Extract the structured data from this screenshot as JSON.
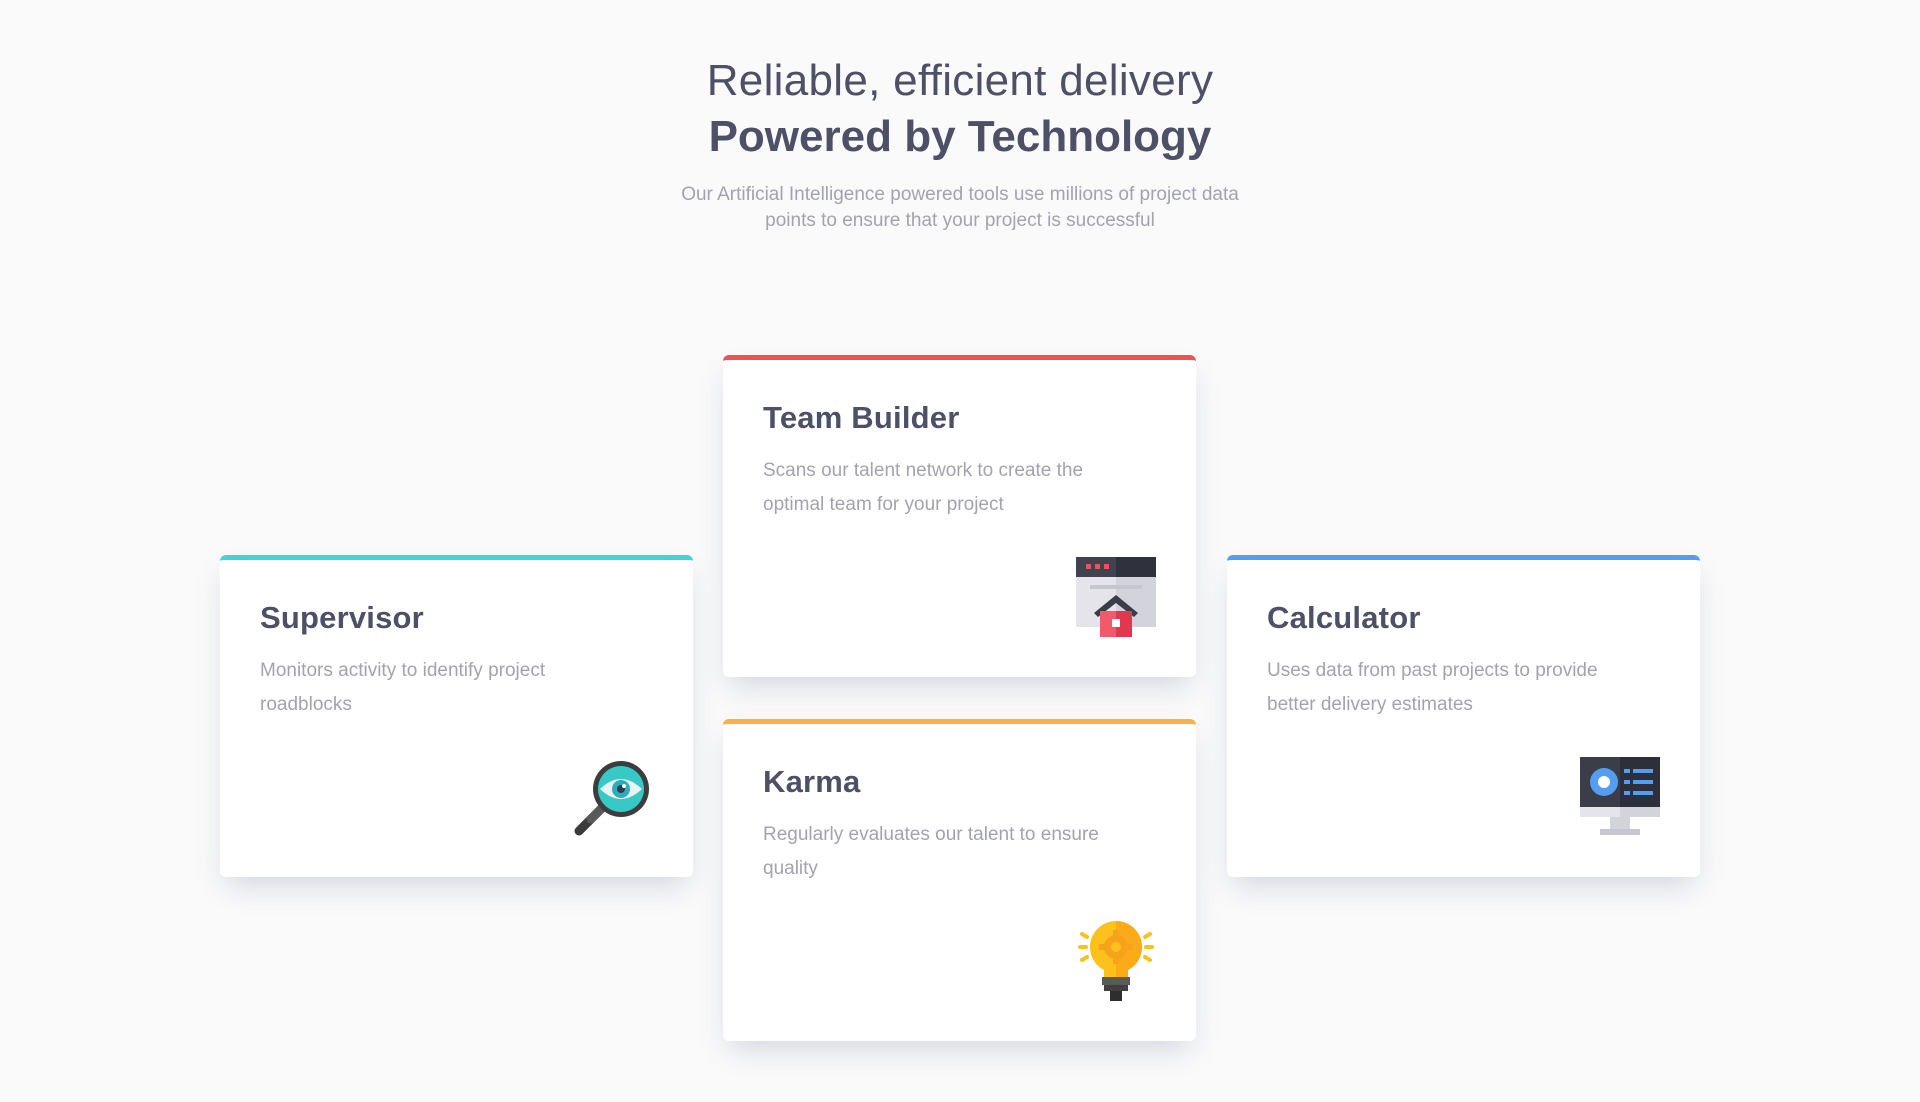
{
  "header": {
    "headline_light": "Reliable, efficient delivery",
    "headline_bold": "Powered by Technology",
    "intro": "Our Artificial Intelligence powered tools use millions of project data points to ensure that your project is successful"
  },
  "cards": [
    {
      "title": "Supervisor",
      "description": "Monitors activity to identify project roadblocks",
      "accent": "#44d3d2",
      "icon": "magnifier-eye-icon"
    },
    {
      "title": "Team Builder",
      "description": "Scans our talent network to create the optimal team for your project",
      "accent": "#ea5454",
      "icon": "window-home-icon"
    },
    {
      "title": "Karma",
      "description": "Regularly evaluates our talent to ensure quality",
      "accent": "#fcaf4a",
      "icon": "lightbulb-gear-icon"
    },
    {
      "title": "Calculator",
      "description": "Uses data from past projects to provide better delivery estimates",
      "accent": "#549ef2",
      "icon": "monitor-dashboard-icon"
    }
  ],
  "colors": {
    "background": "#fafafa",
    "heading": "#4d5066",
    "body_text": "#a3a3ae",
    "card_background": "#ffffff"
  }
}
